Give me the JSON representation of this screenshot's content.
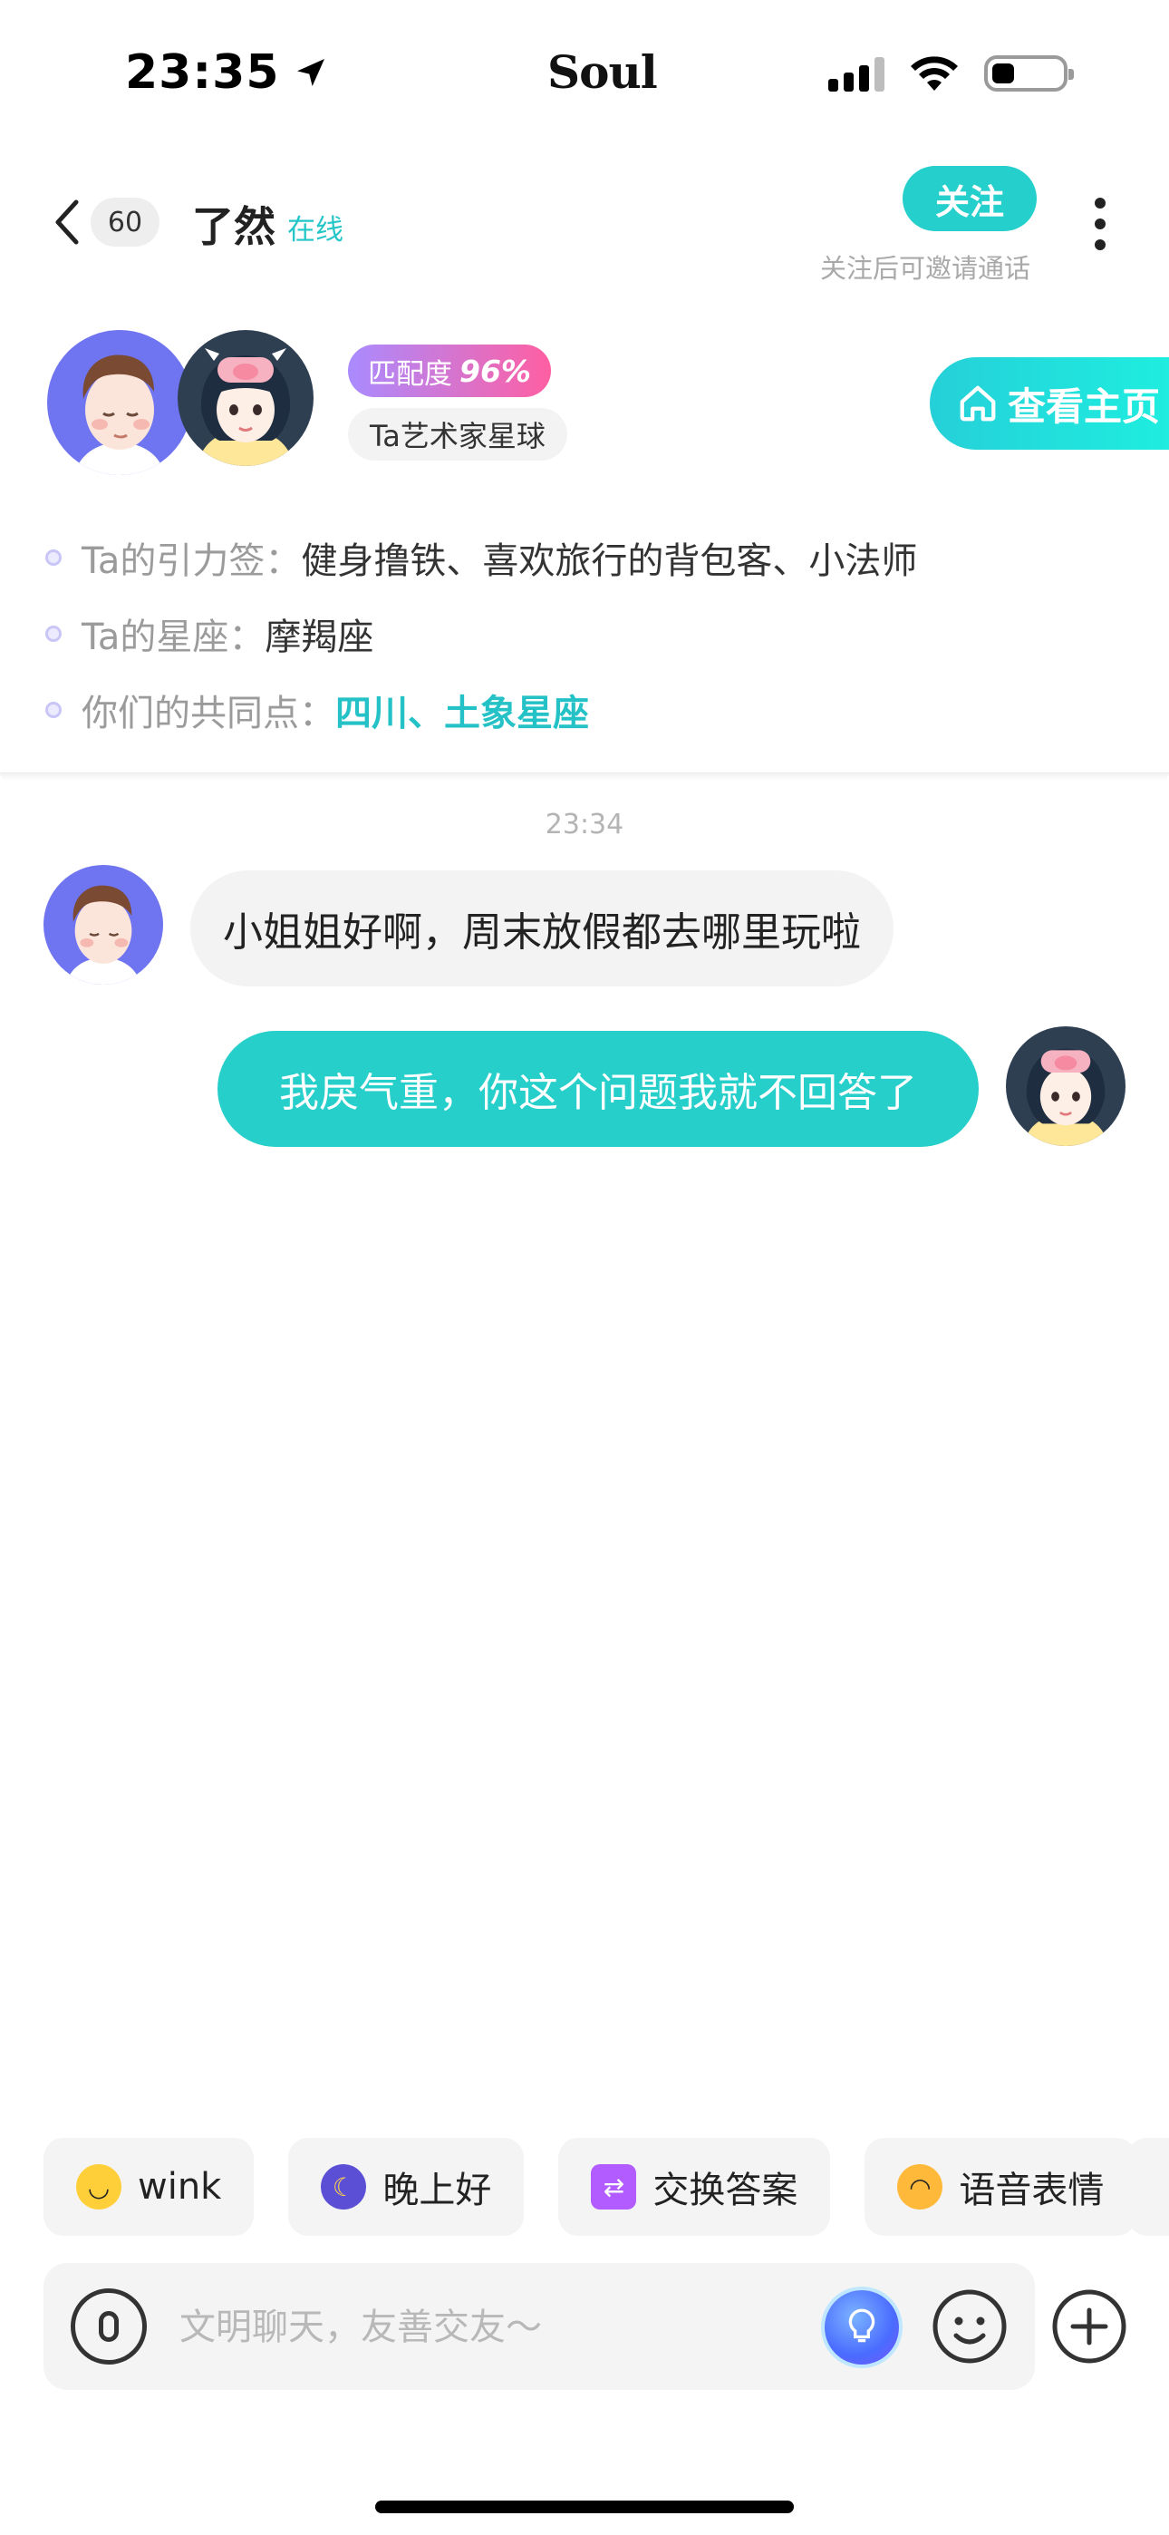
{
  "status_bar": {
    "time": "23:35",
    "brand": "Soul"
  },
  "header": {
    "back_count": "60",
    "name": "了然",
    "online_status": "在线",
    "follow_label": "关注",
    "follow_tip": "关注后可邀请通话"
  },
  "profile": {
    "match_label": "匹配度",
    "match_value": "96%",
    "planet": "Ta艺术家星球",
    "homepage_label": "查看主页",
    "info": [
      {
        "label": "Ta的引力签：",
        "value": "健身撸铁、喜欢旅行的背包客、小法师"
      },
      {
        "label": "Ta的星座：",
        "value": "摩羯座"
      },
      {
        "label": "你们的共同点：",
        "value": "四川、土象星座"
      }
    ]
  },
  "chat": {
    "timestamp": "23:34",
    "messages": [
      {
        "from": "other",
        "text": "小姐姐好啊，周末放假都去哪里玩啦"
      },
      {
        "from": "me",
        "text": "我戾气重，你这个问题我就不回答了"
      }
    ]
  },
  "quick_replies": [
    {
      "label": "wink",
      "icon": "wink-emoji-icon"
    },
    {
      "label": "晚上好",
      "icon": "moon-emoji-icon"
    },
    {
      "label": "交换答案",
      "icon": "exchange-icon"
    },
    {
      "label": "语音表情",
      "icon": "voice-emoji-icon"
    }
  ],
  "input": {
    "placeholder": "文明聊天，友善交友～"
  },
  "colors": {
    "accent": "#27cfcb",
    "match_gradient_start": "#a98bff",
    "match_gradient_end": "#ff5fa2"
  }
}
